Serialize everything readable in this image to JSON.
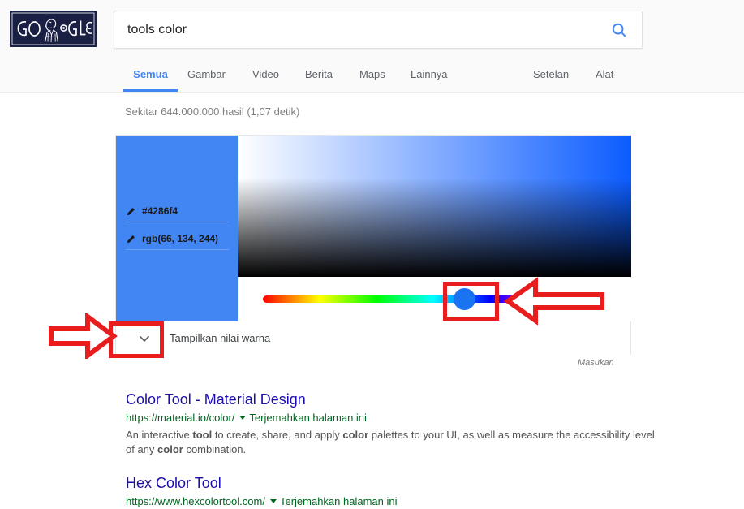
{
  "header": {
    "logo_alt": "google-doodle-logo",
    "search": {
      "value": "tools color",
      "placeholder": "Telusuri",
      "button_icon": "search-icon"
    },
    "tabs": [
      {
        "label": "Semua",
        "active": true
      },
      {
        "label": "Gambar",
        "active": false
      },
      {
        "label": "Video",
        "active": false
      },
      {
        "label": "Berita",
        "active": false
      },
      {
        "label": "Maps",
        "active": false
      },
      {
        "label": "Lainnya",
        "active": false
      }
    ],
    "right_links": [
      {
        "label": "Setelan"
      },
      {
        "label": "Alat"
      }
    ]
  },
  "stats": {
    "text": "Sekitar 644.000.000 hasil (1,07 detik)"
  },
  "color_picker": {
    "swatch_color": "#4286f4",
    "values": [
      {
        "icon": "pencil-icon",
        "text": "#4286f4"
      },
      {
        "icon": "pencil-icon",
        "text": "rgb(66, 134, 244)"
      }
    ],
    "show_values_label": "Tampilkan nilai warna",
    "chevron_icon": "chevron-down-icon",
    "feedback_label": "Masukan",
    "hue_thumb_color": "#1a73f0",
    "sv_cursor_icon": "circle-cursor-icon"
  },
  "results": [
    {
      "title": "Color Tool - Material Design",
      "url": "https://material.io/color/",
      "translate": "Terjemahkan halaman ini",
      "snippet_parts": [
        {
          "t": "An interactive ",
          "b": false
        },
        {
          "t": "tool",
          "b": true
        },
        {
          "t": " to create, share, and apply ",
          "b": false
        },
        {
          "t": "color",
          "b": true
        },
        {
          "t": " palettes to your UI, as well as measure the accessibility level of any ",
          "b": false
        },
        {
          "t": "color",
          "b": true
        },
        {
          "t": " combination.",
          "b": false
        }
      ]
    },
    {
      "title": "Hex Color Tool",
      "url": "https://www.hexcolortool.com/",
      "translate": "Terjemahkan halaman ini",
      "snippet_parts": []
    }
  ],
  "annotations": {
    "color": "#e81e1e",
    "items": [
      {
        "name": "annotation-box-hue-thumb",
        "type": "box"
      },
      {
        "name": "annotation-arrow-to-hue-thumb",
        "type": "arrow-left"
      },
      {
        "name": "annotation-box-chevron",
        "type": "box"
      },
      {
        "name": "annotation-arrow-to-chevron",
        "type": "arrow-right"
      }
    ]
  }
}
